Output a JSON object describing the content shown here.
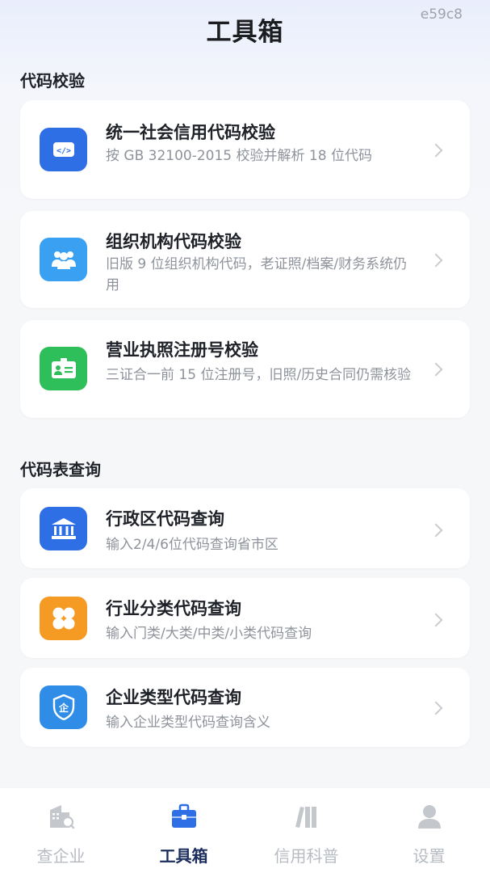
{
  "header": {
    "title": "工具箱",
    "tag": "e59c8"
  },
  "sections": [
    {
      "title": "代码校验",
      "items": [
        {
          "title": "统一社会信用代码校验",
          "desc": "按 GB 32100-2015 校验并解析 18 位代码",
          "icon": "code-icon",
          "color": "#2f6fe6"
        },
        {
          "title": "组织机构代码校验",
          "desc": "旧版 9 位组织机构代码，老证照/档案/财务系统仍用",
          "icon": "group-icon",
          "color": "#3aa0f2"
        },
        {
          "title": "营业执照注册号校验",
          "desc": "三证合一前 15 位注册号，旧照/历史合同仍需核验",
          "icon": "id-card-icon",
          "color": "#2fbf5a"
        }
      ]
    },
    {
      "title": "代码表查询",
      "items": [
        {
          "title": "行政区代码查询",
          "desc": "输入2/4/6位代码查询省市区",
          "icon": "government-building-icon",
          "color": "#2f6fe6"
        },
        {
          "title": "行业分类代码查询",
          "desc": "输入门类/大类/中类/小类代码查询",
          "icon": "four-petal-icon",
          "color": "#f59a23"
        },
        {
          "title": "企业类型代码查询",
          "desc": "输入企业类型代码查询含义",
          "icon": "enterprise-shield-icon",
          "color": "#2f8de8"
        }
      ]
    }
  ],
  "tabbar": {
    "tabs": [
      {
        "label": "查企业",
        "icon": "company-search-icon",
        "active": false
      },
      {
        "label": "工具箱",
        "icon": "toolbox-icon",
        "active": true
      },
      {
        "label": "信用科普",
        "icon": "books-icon",
        "active": false
      },
      {
        "label": "设置",
        "icon": "user-icon",
        "active": false
      }
    ]
  }
}
